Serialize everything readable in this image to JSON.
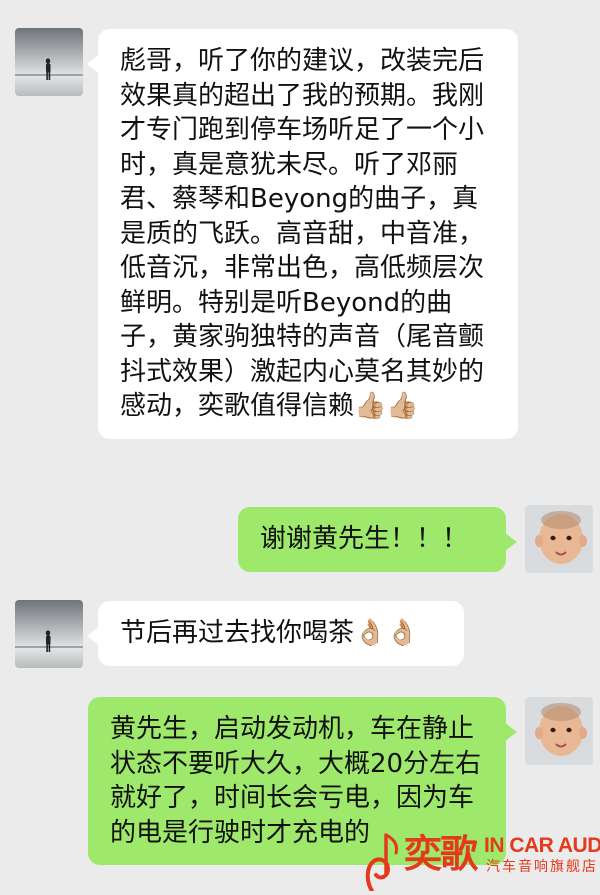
{
  "messages": [
    {
      "side": "in",
      "text": "彪哥，听了你的建议，改装完后效果真的超出了我的预期。我刚才专门跑到停车场听足了一个小时，真是意犹未尽。听了邓丽君、蔡琴和Beyong的曲子，真是质的飞跃。高音甜，中音准，低音沉，非常出色，高低频层次鲜明。特别是听Beyond的曲子，黄家驹独特的声音（尾音颤抖式效果）激起内心莫名其妙的感动，奕歌值得信赖",
      "emoji": "👍🏼👍🏼"
    },
    {
      "side": "out",
      "text": "谢谢黄先生！！！",
      "emoji": ""
    },
    {
      "side": "in",
      "text": "节后再过去找你喝茶",
      "emoji": "👌🏼👌🏼"
    },
    {
      "side": "out",
      "text": "黄先生，启动发动机，车在静止状态不要听大久，大概20分左右就好了，时间长会亏电，因为车的电是行驶时才充电的",
      "emoji": ""
    }
  ],
  "watermark": {
    "brand": "奕歌",
    "english": "IN CAR AUDIO",
    "chinese": "汽车音响旗舰店"
  },
  "colors": {
    "background": "#ebebeb",
    "incoming_bubble": "#ffffff",
    "outgoing_bubble": "#9ee86b",
    "watermark": "#e33a1c"
  },
  "icons": {
    "contact_avatar": "silhouette-on-beach-photo",
    "self_avatar": "baby-photo"
  }
}
